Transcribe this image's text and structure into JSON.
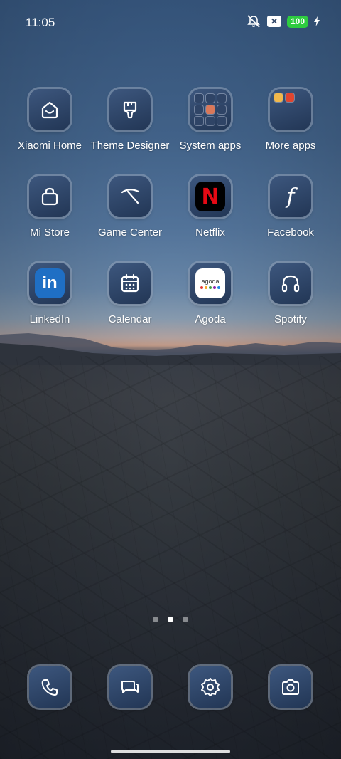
{
  "status_bar": {
    "time": "11:05",
    "battery_level": "100",
    "icons": [
      "mute-vibrate-icon",
      "no-sim-icon",
      "battery-icon",
      "charging-bolt-icon"
    ]
  },
  "home_screen": {
    "rows": [
      [
        {
          "label": "Xiaomi Home",
          "icon": "xiaomi-home-icon"
        },
        {
          "label": "Theme Designer",
          "icon": "paintbrush-icon"
        },
        {
          "label": "System apps",
          "icon": "folder-icon"
        },
        {
          "label": "More apps",
          "icon": "folder-icon"
        }
      ],
      [
        {
          "label": "Mi Store",
          "icon": "shopping-bag-icon"
        },
        {
          "label": "Game Center",
          "icon": "game-center-icon"
        },
        {
          "label": "Netflix",
          "icon": "netflix-icon"
        },
        {
          "label": "Facebook",
          "icon": "facebook-icon"
        }
      ],
      [
        {
          "label": "LinkedIn",
          "icon": "linkedin-icon"
        },
        {
          "label": "Calendar",
          "icon": "calendar-icon"
        },
        {
          "label": "Agoda",
          "icon": "agoda-icon"
        },
        {
          "label": "Spotify",
          "icon": "headphones-icon"
        }
      ]
    ],
    "netflix_letter": "N",
    "linkedin_letters": "in",
    "facebook_letter": "f",
    "agoda_wordmark": "agoda",
    "agoda_dot_colors": [
      "#e53935",
      "#f9a825",
      "#43a047",
      "#8e24aa",
      "#1e88e5"
    ]
  },
  "page_indicator": {
    "pages": 3,
    "active_page": 2
  },
  "dock": [
    {
      "name": "phone",
      "icon": "phone-icon"
    },
    {
      "name": "messages",
      "icon": "messages-icon"
    },
    {
      "name": "settings",
      "icon": "gear-icon"
    },
    {
      "name": "camera",
      "icon": "camera-icon"
    }
  ],
  "colors": {
    "icon_bg": "#2c4468",
    "battery_green": "#2ecc40",
    "netflix_red": "#e50914",
    "linkedin_blue": "#1f6fc4"
  }
}
